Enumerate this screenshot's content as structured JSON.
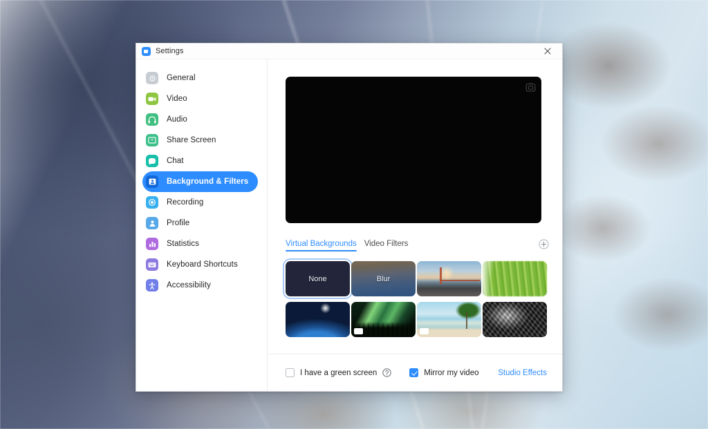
{
  "window": {
    "title": "Settings",
    "app_icon": "zoom-logo-icon",
    "close_icon": "close-icon"
  },
  "sidebar": {
    "items": [
      {
        "label": "General",
        "icon": "gear-icon",
        "color": "#c8cdd4",
        "active": false
      },
      {
        "label": "Video",
        "icon": "video-camera-icon",
        "color": "#8ec641",
        "active": false
      },
      {
        "label": "Audio",
        "icon": "headphones-icon",
        "color": "#3fbf7f",
        "active": false
      },
      {
        "label": "Share Screen",
        "icon": "share-screen-icon",
        "color": "#3cbf8a",
        "active": false
      },
      {
        "label": "Chat",
        "icon": "chat-bubble-icon",
        "color": "#17bfa8",
        "active": false
      },
      {
        "label": "Background & Filters",
        "icon": "background-icon",
        "color": "#2d8cff",
        "active": true
      },
      {
        "label": "Recording",
        "icon": "record-icon",
        "color": "#36b0f0",
        "active": false
      },
      {
        "label": "Profile",
        "icon": "profile-icon",
        "color": "#56a8e8",
        "active": false
      },
      {
        "label": "Statistics",
        "icon": "bar-chart-icon",
        "color": "#b06ae0",
        "active": false
      },
      {
        "label": "Keyboard Shortcuts",
        "icon": "keyboard-icon",
        "color": "#8e7ae0",
        "active": false
      },
      {
        "label": "Accessibility",
        "icon": "accessibility-icon",
        "color": "#6f7ee8",
        "active": false
      }
    ]
  },
  "preview": {
    "capture_icon": "camera-capture-icon"
  },
  "tabs": {
    "items": [
      {
        "label": "Virtual Backgrounds",
        "active": true
      },
      {
        "label": "Video Filters",
        "active": false
      }
    ],
    "add_icon": "add-circle-icon"
  },
  "backgrounds": [
    {
      "label": "None",
      "art": "art-none",
      "selected": true,
      "video": false,
      "name": "background-none"
    },
    {
      "label": "Blur",
      "art": "art-blur",
      "selected": false,
      "video": false,
      "name": "background-blur"
    },
    {
      "label": "",
      "art": "art-bridge",
      "selected": false,
      "video": false,
      "name": "background-golden-gate-bridge"
    },
    {
      "label": "",
      "art": "art-grass",
      "selected": false,
      "video": false,
      "name": "background-grass"
    },
    {
      "label": "",
      "art": "art-earth",
      "selected": false,
      "video": false,
      "name": "background-earth-from-space"
    },
    {
      "label": "",
      "art": "art-aurora",
      "selected": false,
      "video": true,
      "name": "background-aurora-forest"
    },
    {
      "label": "",
      "art": "art-beach",
      "selected": false,
      "video": true,
      "name": "background-beach-palm"
    },
    {
      "label": "",
      "art": "art-stone",
      "selected": false,
      "video": false,
      "name": "background-stone-texture"
    }
  ],
  "footer": {
    "green_screen_label": "I have a green screen",
    "green_screen_checked": false,
    "help_icon": "help-circle-icon",
    "mirror_label": "Mirror my video",
    "mirror_checked": true,
    "studio_effects_label": "Studio Effects"
  },
  "colors": {
    "accent": "#2d8cff",
    "selection_ring": "#a8c9f5",
    "preview_background": "#050505"
  }
}
